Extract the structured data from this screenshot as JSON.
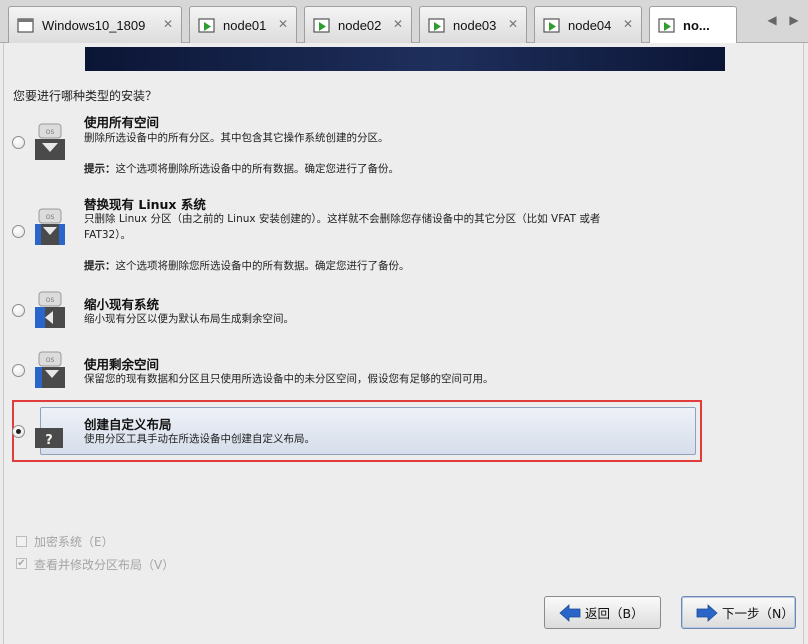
{
  "tabs": [
    {
      "label": "Windows10_1809",
      "icon": "vm-window-icon",
      "active": false
    },
    {
      "label": "node01",
      "icon": "vm-running-icon",
      "active": false
    },
    {
      "label": "node02",
      "icon": "vm-running-icon",
      "active": false
    },
    {
      "label": "node03",
      "icon": "vm-running-icon",
      "active": false
    },
    {
      "label": "node04",
      "icon": "vm-running-icon",
      "active": false
    },
    {
      "label": "no...",
      "icon": "vm-running-icon",
      "active": true
    }
  ],
  "tab_close_glyph": "✕",
  "tab_scroll_left": "◀",
  "tab_scroll_right": "▶",
  "installer": {
    "question": "您要进行哪种类型的安装？",
    "options": [
      {
        "title": "使用所有空间",
        "description": "删除所选设备中的所有分区。其中包含其它操作系统创建的分区。",
        "hint_label": "提示：",
        "hint": "这个选项将删除所选设备中的所有数据。确定您进行了备份。",
        "icon": "disk-use-all-icon",
        "selected": false
      },
      {
        "title": "替换现有 Linux 系统",
        "description": "只删除 Linux 分区（由之前的 Linux 安装创建的）。这样就不会删除您存储设备中的其它分区（比如 VFAT 或者 FAT32）。",
        "hint_label": "提示：",
        "hint": "这个选项将删除您所选设备中的所有数据。确定您进行了备份。",
        "icon": "disk-replace-linux-icon",
        "selected": false
      },
      {
        "title": "缩小现有系统",
        "description": "缩小现有分区以便为默认布局生成剩余空间。",
        "icon": "disk-shrink-icon",
        "selected": false
      },
      {
        "title": "使用剩余空间",
        "description": "保留您的现有数据和分区且只使用所选设备中的未分区空间，假设您有足够的空间可用。",
        "icon": "disk-free-space-icon",
        "selected": false
      },
      {
        "title": "创建自定义布局",
        "description": "使用分区工具手动在所选设备中创建自定义布局。",
        "icon": "custom-layout-question-icon",
        "selected": true
      }
    ],
    "icon_os_text": "OS",
    "icon_custom_text": "?",
    "encrypt_label": "加密系统（E）",
    "encrypt_checked": false,
    "review_label": "查看并修改分区布局（V）",
    "review_checked": true,
    "check_glyph": "✔",
    "back_label": "返回（B）",
    "next_label": "下一步（N）"
  },
  "colors": {
    "highlight_border": "#e23b3b",
    "banner": "#0b1535",
    "arrow_blue": "#2a66c9"
  }
}
